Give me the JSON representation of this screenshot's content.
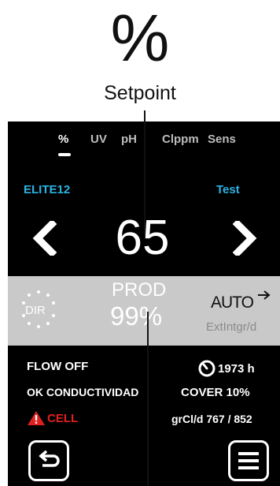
{
  "callout": {
    "symbol": "%",
    "caption": "Setpoint"
  },
  "tabs": [
    {
      "label": "%",
      "active": true
    },
    {
      "label": "UV",
      "active": false
    },
    {
      "label": "pH",
      "active": false
    },
    {
      "label": "Clppm",
      "active": false
    },
    {
      "label": "Sens",
      "active": false
    }
  ],
  "model": "ELITE12",
  "test": "Test",
  "setpoint": {
    "value": "65",
    "left_icon": "chevron-left-icon",
    "right_icon": "chevron-right-icon"
  },
  "production": {
    "dir": "DIR",
    "label": "PROD",
    "value": "99%",
    "mode": "AUTO",
    "mode_icon": "arrow-right-icon",
    "source": "ExtIntgr/d"
  },
  "status": {
    "flow": "FLOW OFF",
    "hours": "1973 h",
    "hours_icon": "gauge-icon",
    "conductivity": "OK CONDUCTIVIDAD",
    "cover": "COVER 10%",
    "cell": "CELL",
    "cell_icon": "warning-icon",
    "grcl": "grCl/d 767 / 852"
  },
  "buttons": {
    "back_icon": "back-icon",
    "menu_icon": "menu-icon"
  },
  "colors": {
    "background": "#000000",
    "accent": "#2bb4e6",
    "band": "#c9c9c9",
    "alert": "#e02020"
  }
}
